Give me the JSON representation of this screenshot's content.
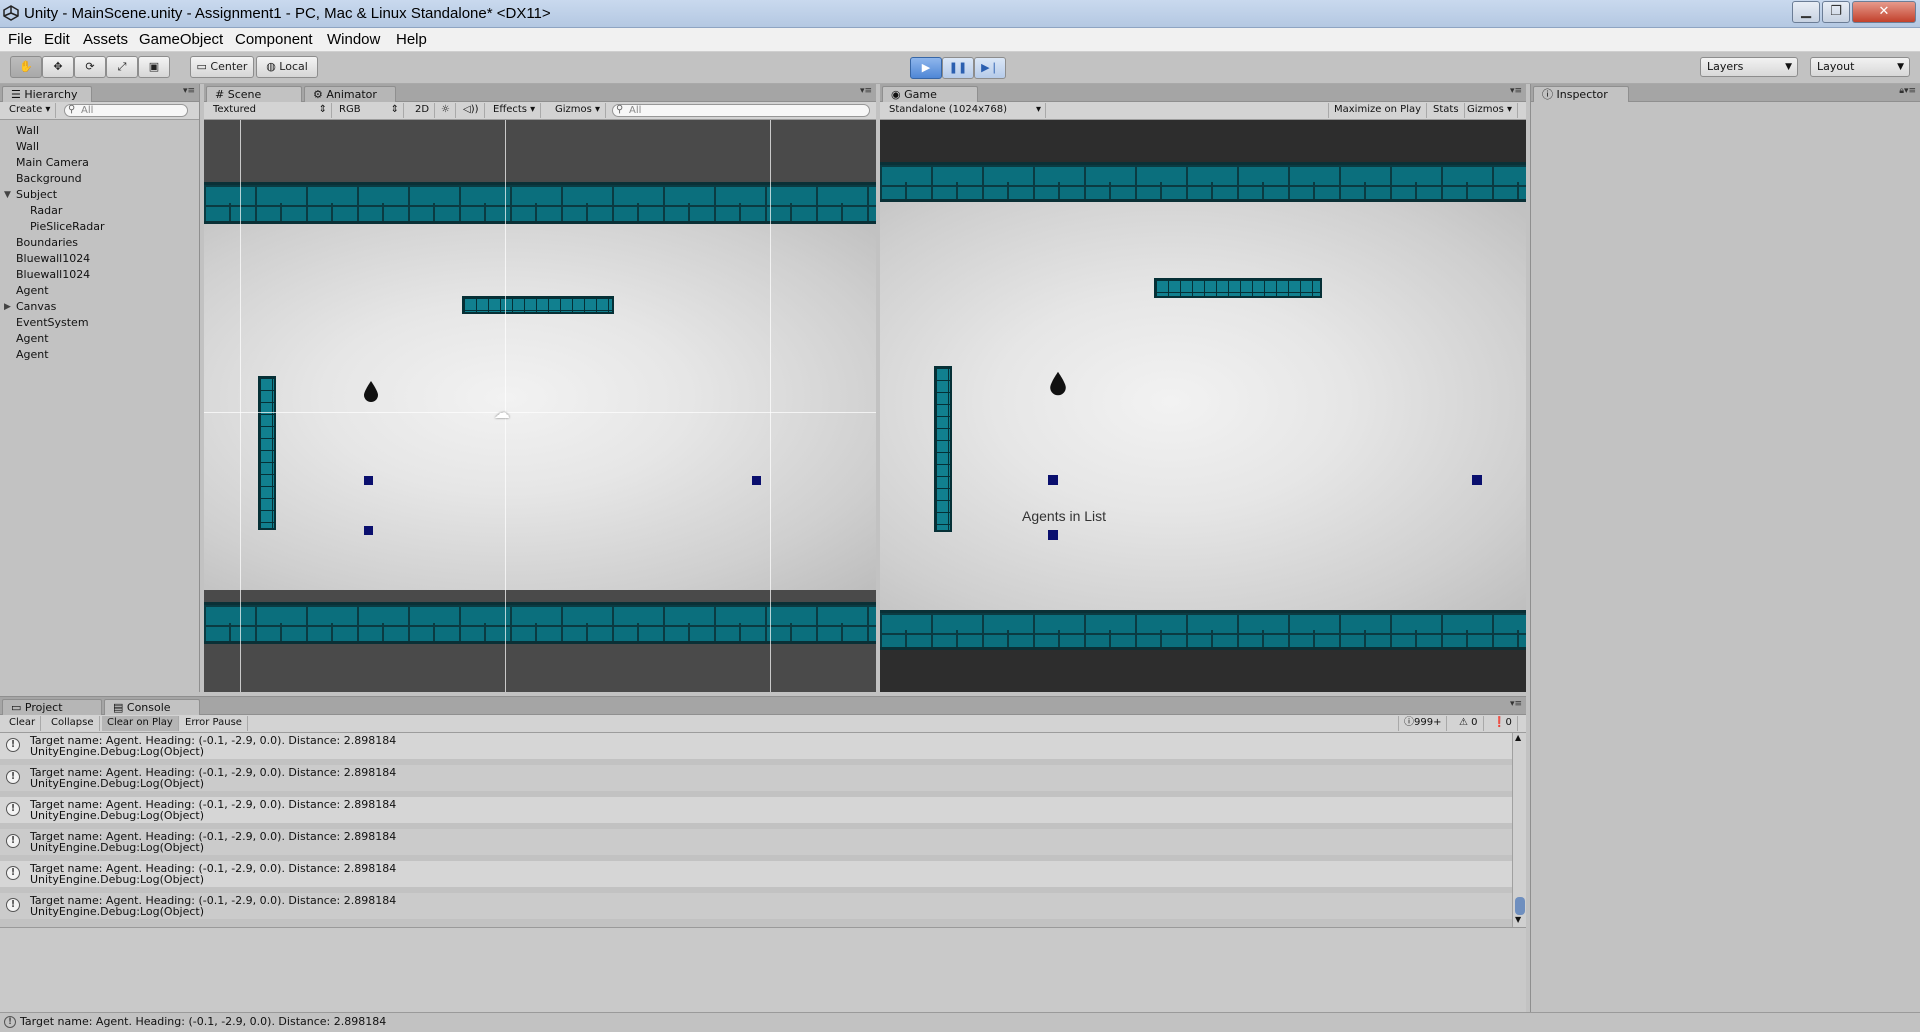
{
  "window": {
    "title": "Unity - MainScene.unity - Assignment1 - PC, Mac & Linux Standalone* <DX11>",
    "minimize_icon": "minimize-icon",
    "maximize_icon": "maximize-icon",
    "close_icon": "close-icon"
  },
  "menu": [
    "File",
    "Edit",
    "Assets",
    "GameObject",
    "Component",
    "Window",
    "Help"
  ],
  "toolbar": {
    "tools": [
      "hand-icon",
      "move-icon",
      "rotate-icon",
      "scale-icon",
      "rect-icon"
    ],
    "pivot_center": "Center",
    "pivot_local": "Local",
    "layers": "Layers",
    "layout": "Layout"
  },
  "hierarchy": {
    "tab": "Hierarchy",
    "create": "Create",
    "search_placeholder": "All",
    "items": [
      "Wall",
      "Wall",
      "Main Camera",
      "Background",
      "Subject",
      "Radar",
      "PieSliceRadar",
      "Boundaries",
      "Bluewall1024",
      "Bluewall1024",
      "Agent",
      "Canvas",
      "EventSystem",
      "Agent",
      "Agent"
    ]
  },
  "scene": {
    "tab": "Scene",
    "animator_tab": "Animator",
    "shading": "Textured",
    "channel": "RGB",
    "mode_2d": "2D",
    "effects": "Effects",
    "gizmos": "Gizmos",
    "search_placeholder": "All"
  },
  "game": {
    "tab": "Game",
    "resolution": "Standalone (1024x768)",
    "maximize": "Maximize on Play",
    "stats": "Stats",
    "gizmos": "Gizmos",
    "overlay_label": "Agents in List"
  },
  "inspector": {
    "tab": "Inspector"
  },
  "console": {
    "project_tab": "Project",
    "console_tab": "Console",
    "clear": "Clear",
    "collapse": "Collapse",
    "clear_on_play": "Clear on Play",
    "error_pause": "Error Pause",
    "log_count": "999+",
    "warn_count": "0",
    "error_count": "0",
    "entries": [
      {
        "line1": "Target name: Agent. Heading: (-0.1, -2.9, 0.0). Distance: 2.898184",
        "line2": "UnityEngine.Debug:Log(Object)"
      },
      {
        "line1": "Target name: Agent. Heading: (-0.1, -2.9, 0.0). Distance: 2.898184",
        "line2": "UnityEngine.Debug:Log(Object)"
      },
      {
        "line1": "Target name: Agent. Heading: (-0.1, -2.9, 0.0). Distance: 2.898184",
        "line2": "UnityEngine.Debug:Log(Object)"
      },
      {
        "line1": "Target name: Agent. Heading: (-0.1, -2.9, 0.0). Distance: 2.898184",
        "line2": "UnityEngine.Debug:Log(Object)"
      },
      {
        "line1": "Target name: Agent. Heading: (-0.1, -2.9, 0.0). Distance: 2.898184",
        "line2": "UnityEngine.Debug:Log(Object)"
      },
      {
        "line1": "Target name: Agent. Heading: (-0.1, -2.9, 0.0). Distance: 2.898184",
        "line2": "UnityEngine.Debug:Log(Object)"
      }
    ]
  },
  "status": {
    "message": "Target name: Agent. Heading: (-0.1, -2.9, 0.0). Distance: 2.898184"
  },
  "colors": {
    "brick": "#0b6f7d",
    "agent": "#0a0f6e",
    "play_blue": "#4f87d6"
  }
}
